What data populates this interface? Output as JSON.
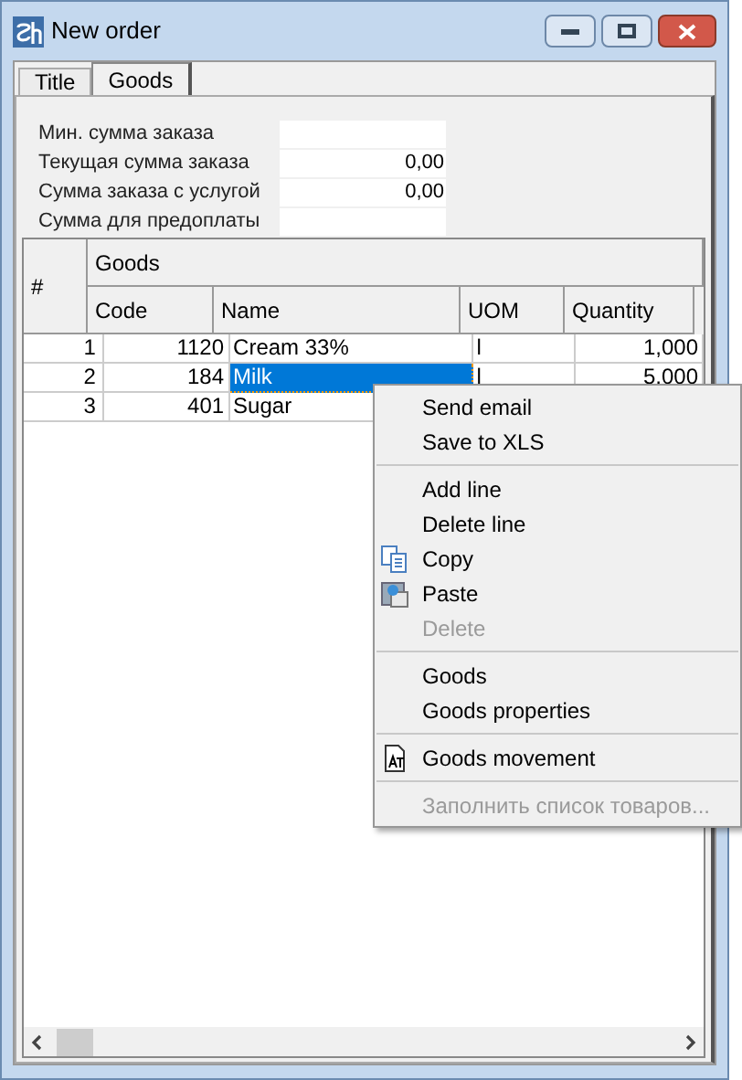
{
  "window": {
    "title": "New order"
  },
  "tabs": [
    {
      "label": "Title",
      "selected": false
    },
    {
      "label": "Goods",
      "selected": true
    }
  ],
  "fields": [
    {
      "label": "Мин. сумма заказа"
    },
    {
      "label": "Текущая сумма заказа",
      "value": "0,00"
    },
    {
      "label": "Сумма заказа с услугой",
      "value": "0,00"
    },
    {
      "label": "Сумма для предоплаты"
    }
  ],
  "table": {
    "row_header": "#",
    "group": "Goods",
    "columns": [
      "Code",
      "Name",
      "UOM",
      "Quantity"
    ],
    "rows": [
      {
        "num": "1",
        "code": "1120",
        "name": "Cream 33%",
        "uom": "l",
        "quantity": "1,000",
        "selected": false
      },
      {
        "num": "2",
        "code": "184",
        "name": "Milk",
        "uom": "l",
        "quantity": "5,000",
        "selected": true
      },
      {
        "num": "3",
        "code": "401",
        "name": "Sugar",
        "selected": false
      }
    ]
  },
  "context_menu": [
    {
      "kind": "item",
      "label": "Send email",
      "disabled": false
    },
    {
      "kind": "item",
      "label": "Save to XLS",
      "disabled": false
    },
    {
      "kind": "separator"
    },
    {
      "kind": "item",
      "label": "Add line",
      "disabled": false
    },
    {
      "kind": "item",
      "label": "Delete line",
      "disabled": false
    },
    {
      "kind": "copy",
      "label": "Copy",
      "disabled": false
    },
    {
      "kind": "paste",
      "label": "Paste",
      "disabled": false
    },
    {
      "kind": "item",
      "label": "Delete",
      "disabled": true
    },
    {
      "kind": "separator"
    },
    {
      "kind": "item",
      "label": "Goods",
      "disabled": false
    },
    {
      "kind": "item",
      "label": "Goods properties",
      "disabled": false
    },
    {
      "kind": "separator"
    },
    {
      "kind": "report",
      "label": "Goods movement",
      "disabled": false
    },
    {
      "kind": "separator"
    },
    {
      "kind": "item",
      "label": "Заполнить список товаров...",
      "disabled": true
    }
  ]
}
